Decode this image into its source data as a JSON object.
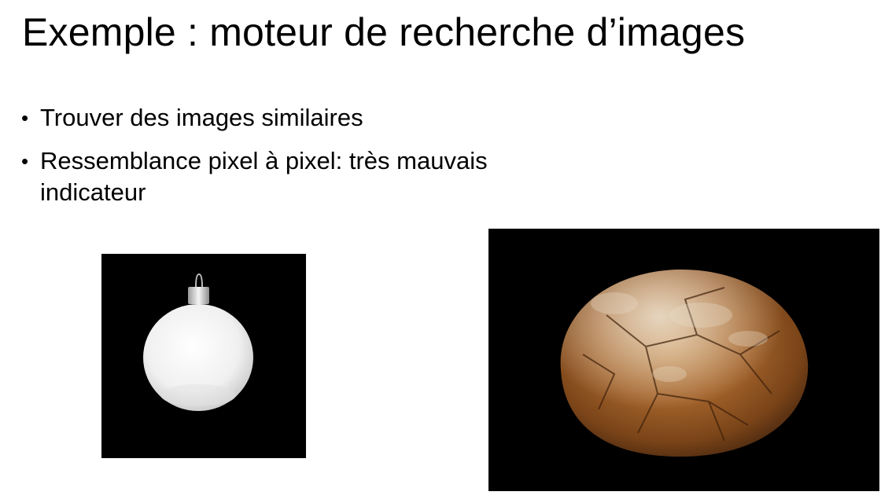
{
  "slide": {
    "title": "Exemple : moteur de recherche d’images",
    "bullets": [
      {
        "marker": "•",
        "text": "Trouver des images similaires"
      },
      {
        "marker": "•",
        "text": "Ressemblance pixel à pixel: très mauvais indicateur"
      }
    ]
  },
  "images": {
    "left": {
      "subject": "white-christmas-ornament",
      "background": "#000000",
      "object_color": "#f2f2f2"
    },
    "right": {
      "subject": "bread-loaf",
      "background": "#000000",
      "crust_color": "#8a4e1e",
      "flour_color": "#d9cfc0"
    }
  }
}
